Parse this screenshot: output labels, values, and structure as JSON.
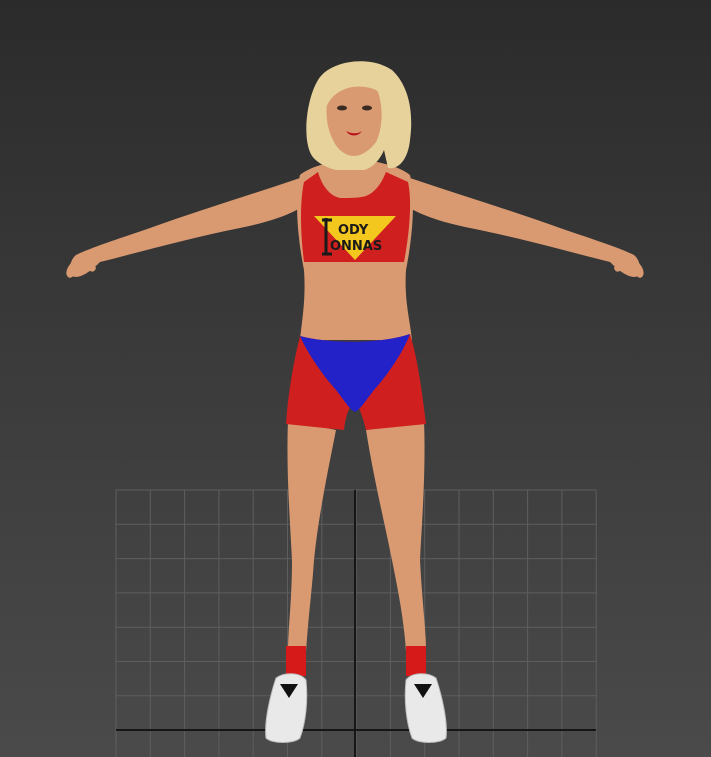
{
  "viewport": {
    "background_top": "#2b2b2b",
    "background_bottom": "#4a4a4a",
    "grid_color": "#5e5e5e",
    "axis_color": "#161616"
  },
  "model": {
    "skin_color": "#d99a72",
    "hair_color": "#e6d29a",
    "top_color": "#cf1f1f",
    "shorts_color": "#cf1f1f",
    "shorts_panel_color": "#2222c8",
    "sock_color": "#d61a1a",
    "shoe_color": "#e9e9e9",
    "logo_triangle_color": "#f3c71e",
    "logo": {
      "line1": "ODY",
      "line2": "ONNAS"
    }
  }
}
